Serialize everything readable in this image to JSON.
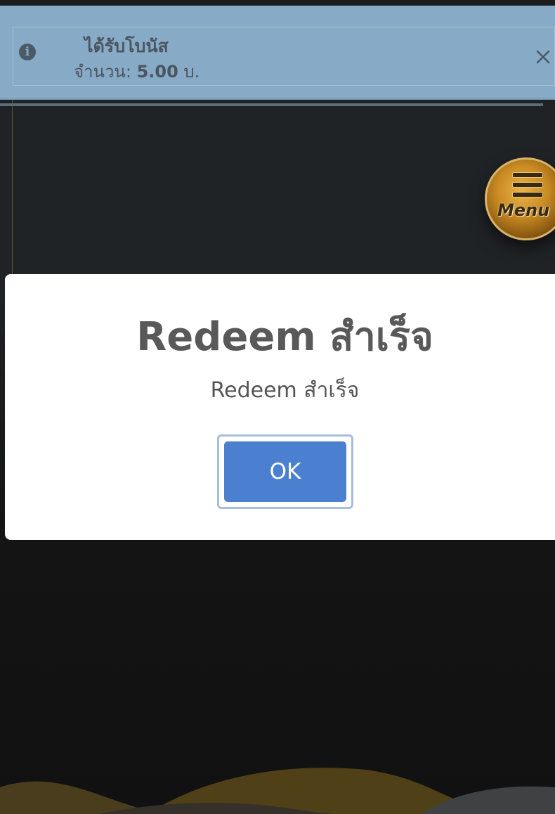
{
  "toast": {
    "title": "ได้รับโบนัส",
    "amount_label": "จำนวน:",
    "amount_value": "5.00",
    "currency": "บ.",
    "icon": "info-icon",
    "close_icon": "close-icon"
  },
  "menu": {
    "label": "Menu",
    "icon": "hamburger-icon"
  },
  "modal": {
    "title": "Redeem สำเร็จ",
    "text": "Redeem สำเร็จ",
    "ok_label": "OK"
  },
  "colors": {
    "toast_bg": "#87abc7",
    "ok_button": "#4a80cf",
    "menu_gold": "#c98a22",
    "background": "#202326"
  }
}
